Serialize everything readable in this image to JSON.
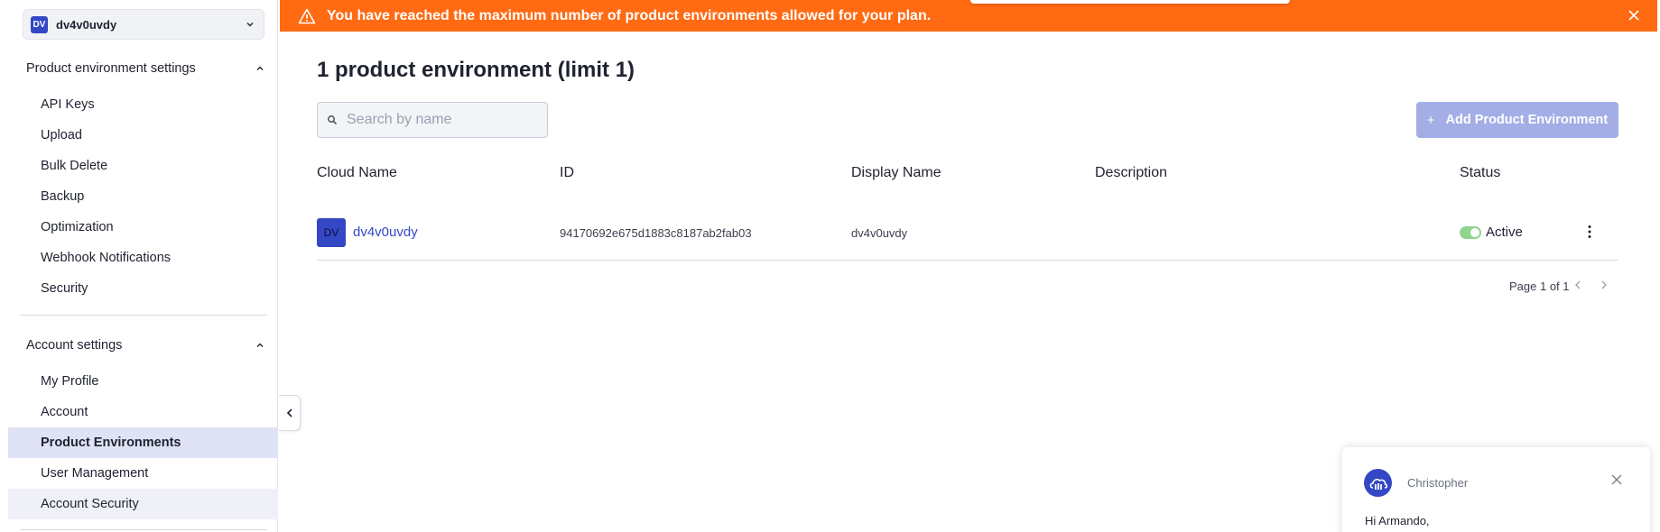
{
  "sidebar": {
    "env_selector": {
      "badge": "DV",
      "name": "dv4v0uvdy"
    },
    "product_settings": {
      "title": "Product environment settings",
      "items": [
        "API Keys",
        "Upload",
        "Bulk Delete",
        "Backup",
        "Optimization",
        "Webhook Notifications",
        "Security"
      ]
    },
    "account_settings": {
      "title": "Account settings",
      "items": [
        "My Profile",
        "Account",
        "Product Environments",
        "User Management",
        "Account Security"
      ],
      "active": "Product Environments"
    }
  },
  "banner": {
    "message": "You have reached the maximum number of product environments allowed for your plan.",
    "color": "#ff6a13"
  },
  "main": {
    "title": "1 product environment (limit 1)",
    "search_placeholder": "Search by name",
    "add_button": {
      "icon": "+",
      "label": "Add Product Environment"
    },
    "columns": [
      "Cloud Name",
      "ID",
      "Display Name",
      "Description",
      "Status"
    ],
    "rows": [
      {
        "badge": "DV",
        "cloud_name": "dv4v0uvdy",
        "id": "94170692e675d1883c8187ab2fab03",
        "display_name": "dv4v0uvdy",
        "description": "",
        "status": "Active"
      }
    ],
    "pagination": "Page 1 of 1"
  },
  "chat": {
    "agent_name": "Christopher",
    "message": "Hi Armando,"
  },
  "colors": {
    "accent": "#3448c5",
    "active_item_bg": "#dfe3f5",
    "status_green": "#8fd48f"
  }
}
